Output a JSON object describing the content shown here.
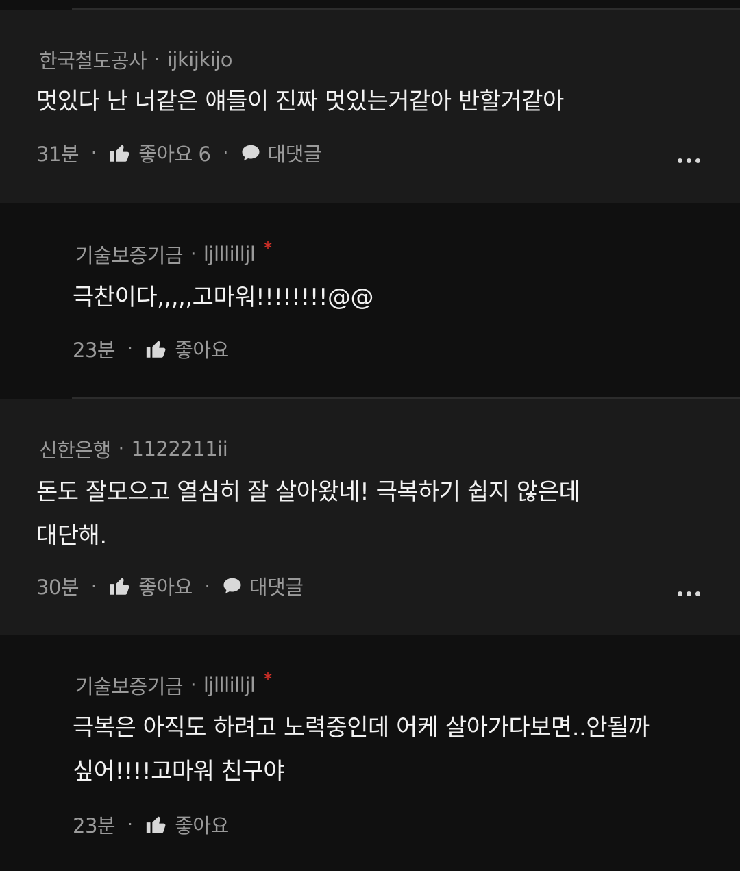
{
  "comments": [
    {
      "author": "한국철도공사",
      "username": "ijkijkijo",
      "lines": [
        "멋있다 난 너같은 얘들이 진짜 멋있는거같아 반할거같아"
      ],
      "time": "31분",
      "like_label": "좋아요 6",
      "reply_label": "대댓글"
    },
    {
      "author": "기술보증기금",
      "username": "ljlllilljl",
      "star": "*",
      "lines": [
        "극찬이다,,,,,고마워!!!!!!!!@@"
      ],
      "time": "23분",
      "like_label": "좋아요"
    },
    {
      "author": "신한은행",
      "username": "1122211ii",
      "lines": [
        "돈도 잘모으고 열심히 잘 살아왔네! 극복하기 쉽지 않은데",
        "대단해."
      ],
      "time": "30분",
      "like_label": "좋아요",
      "reply_label": "대댓글"
    },
    {
      "author": "기술보증기금",
      "username": "ljlllilljl",
      "star": "*",
      "lines": [
        "극복은 아직도 하려고 노력중인데 어케 살아가다보면..안될까",
        "싶어!!!!고마워 친구야"
      ],
      "time": "23분",
      "like_label": "좋아요"
    }
  ],
  "separator_dot": "·",
  "icons": {
    "like": "thumbs-up-icon",
    "reply": "speech-bubble-icon",
    "more": "more-horizontal-icon"
  },
  "colors": {
    "background": "#101010",
    "top_comment_bg": "#1b1b1b",
    "text": "#f2f2f2",
    "muted": "#9a9a9a",
    "star": "#e0322a"
  }
}
